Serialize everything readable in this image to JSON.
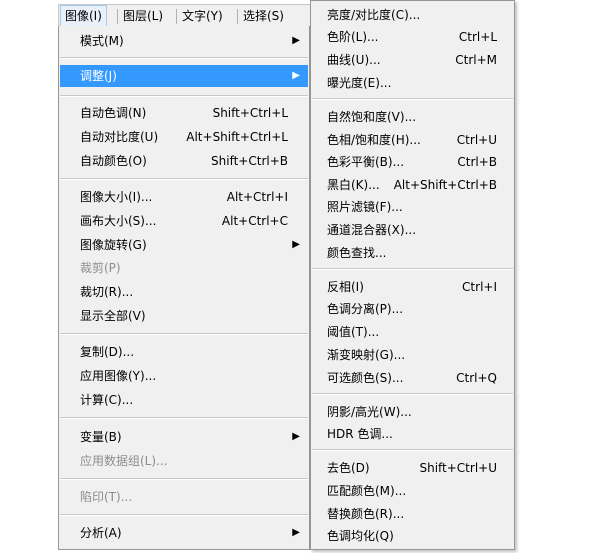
{
  "menubar": [
    "图像(I)",
    "图层(L)",
    "文字(Y)",
    "选择(S)"
  ],
  "main_menu": {
    "mode": "模式(M)",
    "adjust": "调整(J)",
    "auto_tone": {
      "label": "自动色调(N)",
      "shortcut": "Shift+Ctrl+L"
    },
    "auto_contrast": {
      "label": "自动对比度(U)",
      "shortcut": "Alt+Shift+Ctrl+L"
    },
    "auto_color": {
      "label": "自动颜色(O)",
      "shortcut": "Shift+Ctrl+B"
    },
    "image_size": {
      "label": "图像大小(I)...",
      "shortcut": "Alt+Ctrl+I"
    },
    "canvas_size": {
      "label": "画布大小(S)...",
      "shortcut": "Alt+Ctrl+C"
    },
    "image_rotation": "图像旋转(G)",
    "crop": "裁剪(P)",
    "trim": "裁切(R)...",
    "reveal_all": "显示全部(V)",
    "duplicate": "复制(D)...",
    "apply_image": "应用图像(Y)...",
    "calculations": "计算(C)...",
    "variables": "变量(B)",
    "apply_data_set": "应用数据组(L)...",
    "trap": "陷印(T)...",
    "analysis": "分析(A)"
  },
  "sub_menu": {
    "brightness": "亮度/对比度(C)...",
    "levels": {
      "label": "色阶(L)...",
      "shortcut": "Ctrl+L"
    },
    "curves": {
      "label": "曲线(U)...",
      "shortcut": "Ctrl+M"
    },
    "exposure": "曝光度(E)...",
    "vibrance": "自然饱和度(V)...",
    "hue_sat": {
      "label": "色相/饱和度(H)...",
      "shortcut": "Ctrl+U"
    },
    "color_balance": {
      "label": "色彩平衡(B)...",
      "shortcut": "Ctrl+B"
    },
    "black_white": {
      "label": "黑白(K)...",
      "shortcut": "Alt+Shift+Ctrl+B"
    },
    "photo_filter": "照片滤镜(F)...",
    "channel_mixer": "通道混合器(X)...",
    "color_lookup": "颜色查找...",
    "invert": {
      "label": "反相(I)",
      "shortcut": "Ctrl+I"
    },
    "posterize": "色调分离(P)...",
    "threshold": "阈值(T)...",
    "gradient_map": "渐变映射(G)...",
    "selective_color": {
      "label": "可选颜色(S)...",
      "shortcut": "Ctrl+Q"
    },
    "shadows_highlights": "阴影/高光(W)...",
    "hdr_toning": "HDR 色调...",
    "desaturate": {
      "label": "去色(D)",
      "shortcut": "Shift+Ctrl+U"
    },
    "match_color": "匹配颜色(M)...",
    "replace_color": "替换颜色(R)...",
    "equalize": "色调均化(Q)"
  }
}
